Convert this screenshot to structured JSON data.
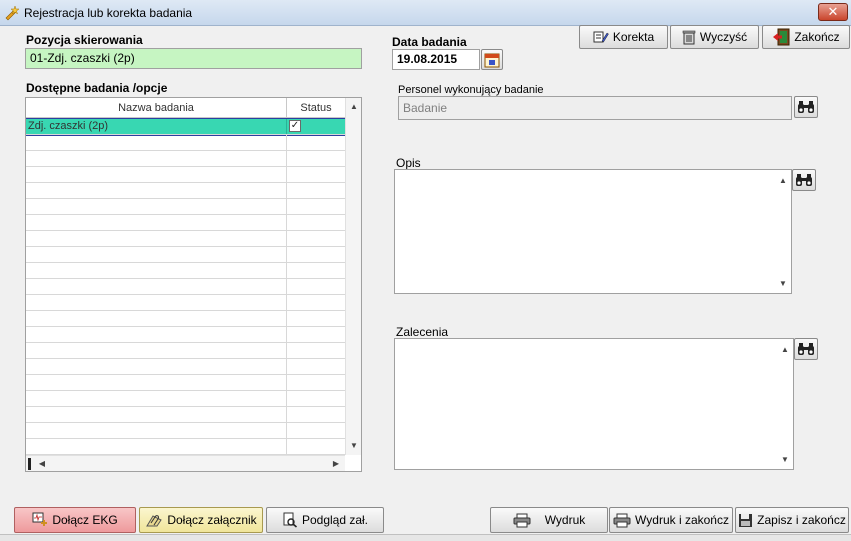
{
  "window": {
    "title": "Rejestracja lub korekta badania",
    "close_label": "✕"
  },
  "form": {
    "referral_label": "Pozycja skierowania",
    "referral_value": "01-Zdj. czaszki (2p)",
    "date_label": "Data badania",
    "date_value": "19.08.2015",
    "available_label": "Dostępne badania /opcje",
    "staff_label": "Personel wykonujący badanie",
    "staff_placeholder": "Badanie",
    "description_label": "Opis",
    "recommendations_label": "Zalecenia"
  },
  "toolbar": {
    "correction_label": "Korekta",
    "clear_label": "Wyczyść",
    "finish_label": "Zakończ"
  },
  "grid": {
    "columns": [
      "Nazwa badania",
      "Status"
    ],
    "rows": [
      {
        "name": "Zdj. czaszki (2p)",
        "checked": true
      }
    ]
  },
  "bottom": {
    "ekg_label": "Dołącz  EKG",
    "attach_label": "Dołącz  załącznik",
    "preview_label": "Podgląd zał.",
    "print_label": "Wydruk",
    "print_finish_label": "Wydruk i zakończ",
    "save_finish_label": "Zapisz i zakończ"
  },
  "colors": {
    "accent_field": "#c6f5c2",
    "selected_row": "#38d7b2",
    "ekg_button": "#f2a6a8",
    "attach_button": "#f5eeb2"
  },
  "icons": {
    "title": "pencil-star-icon",
    "correction": "edit-icon",
    "clear": "trash-icon",
    "finish": "exit-icon",
    "calendar": "calendar-icon",
    "search": "binoculars-icon",
    "ekg": "ekg-icon",
    "attach": "paperclip-icon",
    "preview": "magnifier-document-icon",
    "print": "printer-icon",
    "save": "floppy-disk-icon"
  }
}
